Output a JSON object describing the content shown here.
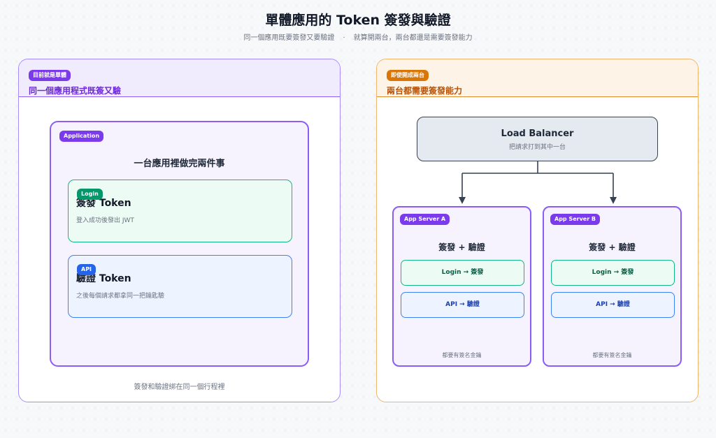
{
  "title": "單體應用的 Token 簽發與驗證",
  "subtitle": {
    "left": "同一個應用既要簽發又要驗證",
    "separator": "·",
    "right": "就算開兩台，兩台都還是需要簽發能力"
  },
  "left_panel": {
    "badge": "目前就是單體",
    "heading": "同一個應用程式既簽又驗",
    "app": {
      "badge": "Application",
      "heading": "一台應用裡做完兩件事",
      "login_card": {
        "badge": "Login",
        "title": "簽發 Token",
        "desc": "登入成功後發出 JWT"
      },
      "api_card": {
        "badge": "API",
        "title": "驗證 Token",
        "desc": "之後每個請求都拿同一把鑰匙驗"
      }
    },
    "footer": "簽發和驗證綁在同一個行程裡"
  },
  "right_panel": {
    "badge": "即使開成兩台",
    "heading": "兩台都需要簽發能力",
    "load_balancer": {
      "title": "Load Balancer",
      "subtitle": "把請求打到其中一台"
    },
    "servers": [
      {
        "badge": "App Server A",
        "heading": "簽發 + 驗證",
        "login": "Login → 簽發",
        "api": "API → 驗證",
        "footer": "都要有簽名金鑰"
      },
      {
        "badge": "App Server B",
        "heading": "簽發 + 驗證",
        "login": "Login → 簽發",
        "api": "API → 驗證",
        "footer": "都要有簽名金鑰"
      }
    ]
  },
  "colors": {
    "purple": "#7c3aed",
    "orange": "#d97706",
    "green": "#059669",
    "blue": "#2563eb"
  }
}
